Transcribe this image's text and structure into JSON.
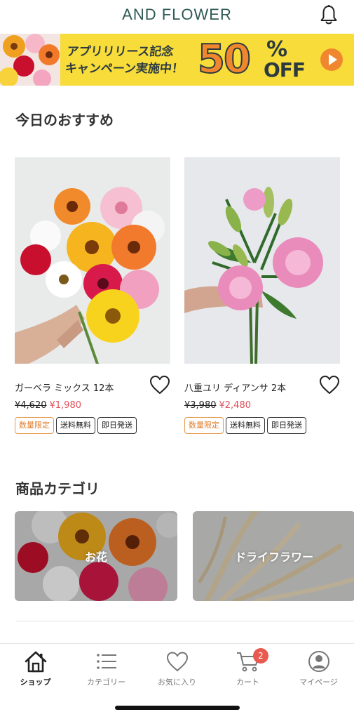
{
  "header": {
    "logo": "AND FLOWER"
  },
  "banner": {
    "line1": "アプリリリース記念",
    "line2": "キャンペーン実施中！",
    "discount": "50",
    "percent": "%",
    "off": "OFF",
    "colors": {
      "background": "#f7dc3a",
      "accent": "#f0872e",
      "text": "#2c3a3f"
    }
  },
  "recommend": {
    "title": "今日のおすすめ",
    "products": [
      {
        "name": "ガーベラ ミックス 12本",
        "old_price": "¥4,620",
        "new_price": "¥1,980",
        "tags": [
          "数量限定",
          "送料無料",
          "即日発送"
        ]
      },
      {
        "name": "八重ユリ ディアンサ 2本",
        "old_price": "¥3,980",
        "new_price": "¥2,480",
        "tags": [
          "数量限定",
          "送料無料",
          "即日発送"
        ]
      }
    ]
  },
  "categories": {
    "title": "商品カテゴリ",
    "items": [
      {
        "label": "お花"
      },
      {
        "label": "ドライフラワー"
      }
    ]
  },
  "tabbar": {
    "items": [
      {
        "label": "ショップ",
        "icon": "home-icon",
        "active": true
      },
      {
        "label": "カテゴリー",
        "icon": "list-icon"
      },
      {
        "label": "お気に入り",
        "icon": "heart-icon"
      },
      {
        "label": "カート",
        "icon": "cart-icon",
        "badge": "2"
      },
      {
        "label": "マイページ",
        "icon": "user-icon"
      }
    ]
  },
  "colors": {
    "sale_price": "#e0505a",
    "limited_tag": "#e07d2a",
    "logo": "#2f5a55",
    "badge": "#e85a4f"
  }
}
